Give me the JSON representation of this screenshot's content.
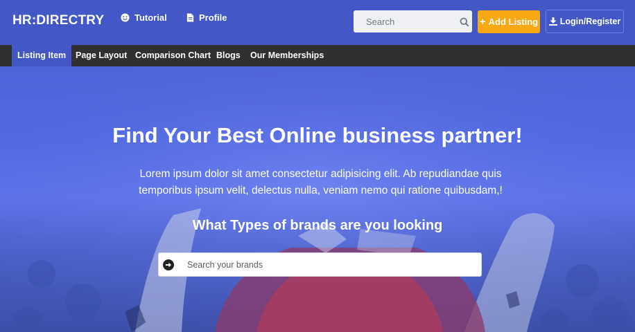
{
  "header": {
    "brand": "HR:DIRECTRY",
    "links": [
      {
        "label": "Tutorial",
        "icon": "smiley-icon"
      },
      {
        "label": "Profile",
        "icon": "document-icon"
      }
    ],
    "search": {
      "placeholder": "Search",
      "value": ""
    },
    "add_listing_label": "Add Listing",
    "login_label": "Login/Register"
  },
  "nav": {
    "items": [
      "Listing Item",
      "Page Layout",
      "Comparison Chart",
      "Blogs",
      "Our Memberships"
    ],
    "active_index": 0
  },
  "hero": {
    "title": "Find Your Best Online business partner!",
    "description": "Lorem ipsum dolor sit amet consectetur adipisicing elit. Ab repudiandae quis temporibus ipsum velit, delectus nulla, veniam nemo qui ratione quibusdam,!",
    "subtitle": "What Types of brands are you looking",
    "brand_search": {
      "placeholder": "Search your brands",
      "value": ""
    }
  },
  "colors": {
    "header_bg": "#4357c7",
    "nav_bg": "#303030",
    "accent_orange": "#f7a813",
    "hero_blue": "#5269e1"
  }
}
